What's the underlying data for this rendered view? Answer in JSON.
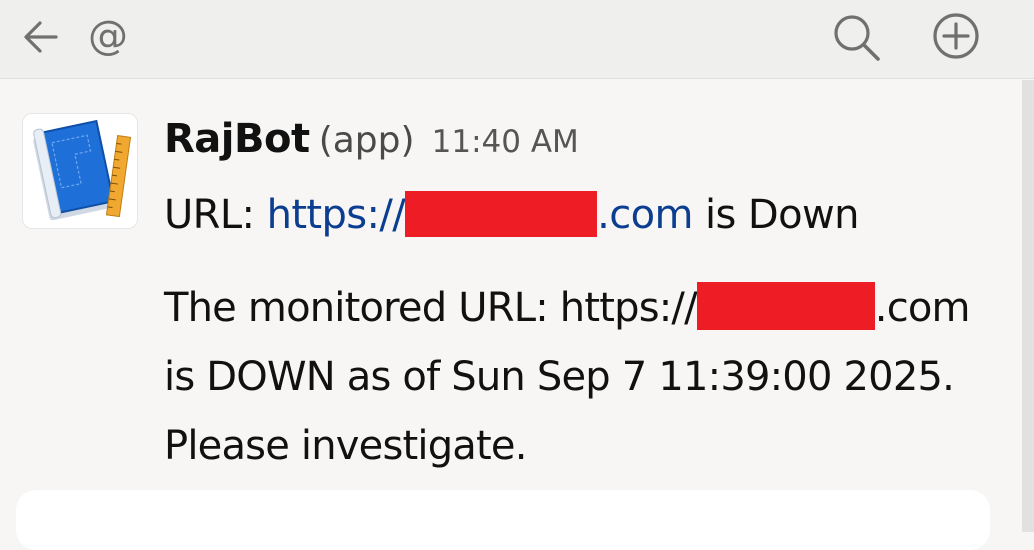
{
  "topbar": {
    "back_icon": "arrow-left-icon",
    "mention_symbol": "@",
    "search_icon": "search-icon",
    "add_icon": "plus-circle-icon"
  },
  "message": {
    "sender": "RajBot",
    "sender_tag": "(app)",
    "time": "11:40 AM",
    "title_prefix": "URL: ",
    "title_link_start": "https://",
    "title_link_end": ".com",
    "title_suffix": " is Down",
    "body_line1_prefix": "The monitored URL: https://",
    "body_line1_suffix": ".com",
    "body_line2": "is DOWN as of Sun Sep 7 11:39:00 2025.",
    "body_line3": "Please investigate."
  },
  "colors": {
    "link": "#0b3d91",
    "redaction": "#ee1c24",
    "topbar_bg": "#efefed",
    "page_bg": "#f8f6f4"
  }
}
